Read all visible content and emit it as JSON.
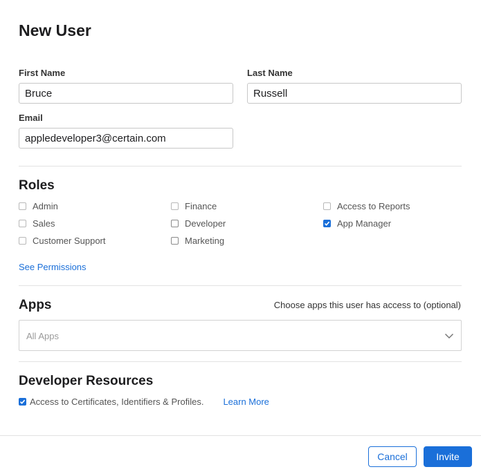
{
  "dialog": {
    "title": "New User"
  },
  "form": {
    "first_name": {
      "label": "First Name",
      "value": "Bruce"
    },
    "last_name": {
      "label": "Last Name",
      "value": "Russell"
    },
    "email": {
      "label": "Email",
      "value": "appledeveloper3@certain.com"
    }
  },
  "roles": {
    "title": "Roles",
    "items": [
      {
        "label": "Admin",
        "checked": false
      },
      {
        "label": "Finance",
        "checked": false
      },
      {
        "label": "Access to Reports",
        "checked": false
      },
      {
        "label": "Sales",
        "checked": false
      },
      {
        "label": "Developer",
        "checked": false
      },
      {
        "label": "App Manager",
        "checked": true
      },
      {
        "label": "Customer Support",
        "checked": false
      },
      {
        "label": "Marketing",
        "checked": false
      }
    ],
    "see_permissions": "See Permissions"
  },
  "apps": {
    "title": "Apps",
    "hint": "Choose apps this user has access to (optional)",
    "select_placeholder": "All Apps"
  },
  "developer_resources": {
    "title": "Developer Resources",
    "checkbox_label": "Access to Certificates, Identifiers & Profiles.",
    "checked": true,
    "learn_more": "Learn More"
  },
  "footer": {
    "cancel_label": "Cancel",
    "invite_label": "Invite"
  },
  "colors": {
    "accent": "#1a6fd9",
    "divider": "#e2e2e2"
  }
}
